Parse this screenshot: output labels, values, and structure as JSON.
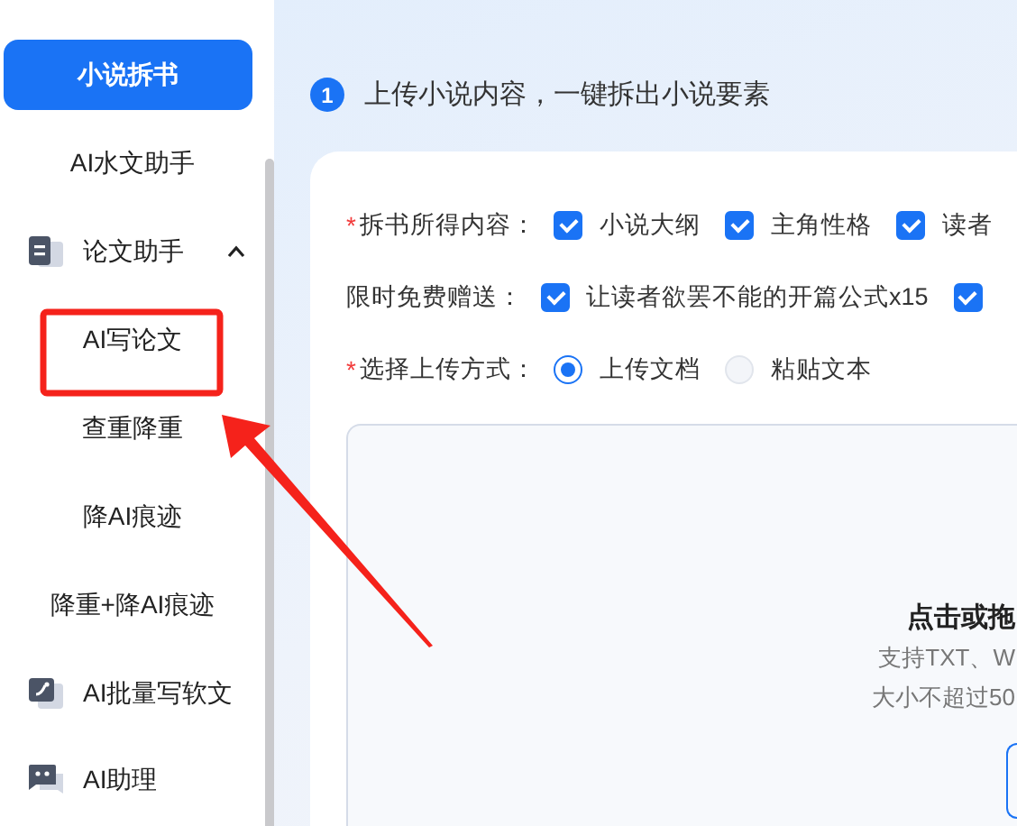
{
  "sidebar": {
    "items": [
      {
        "kind": "primary",
        "label": "小说拆书",
        "selected": true
      },
      {
        "kind": "plain",
        "label": "AI水文助手",
        "selected": false
      },
      {
        "kind": "group",
        "label": "论文助手",
        "expanded": true,
        "selected": false,
        "children": [
          {
            "label": "AI写论文",
            "selected": false
          },
          {
            "label": "查重降重",
            "selected": false
          },
          {
            "label": "降AI痕迹",
            "selected": false
          },
          {
            "label": "降重+降AI痕迹",
            "selected": false
          }
        ]
      },
      {
        "kind": "icon",
        "label": "AI批量写软文",
        "selected": false
      },
      {
        "kind": "icon",
        "label": "AI助理",
        "selected": false
      }
    ]
  },
  "step": {
    "number": "1",
    "title": "上传小说内容，一键拆出小说要素"
  },
  "form": {
    "rows": [
      {
        "kind": "checks",
        "label": "拆书所得内容：",
        "required_mark": "*",
        "options": [
          {
            "label": "小说大纲",
            "checked": true
          },
          {
            "label": "主角性格",
            "checked": true
          },
          {
            "label": "读者",
            "checked": true
          }
        ]
      },
      {
        "kind": "checks",
        "label": "限时免费赠送：",
        "options": [
          {
            "label": "让读者欲罢不能的开篇公式x15",
            "checked": true
          },
          {
            "checked": true
          }
        ]
      },
      {
        "kind": "radios",
        "label": "选择上传方式：",
        "required_mark": "*",
        "options": [
          {
            "label": "上传文档",
            "selected": true
          },
          {
            "label": "粘贴文本",
            "selected": false
          }
        ]
      }
    ]
  },
  "upload": {
    "title": "点击或拖",
    "lines": [
      "支持TXT、W",
      "大小不超过50"
    ]
  }
}
